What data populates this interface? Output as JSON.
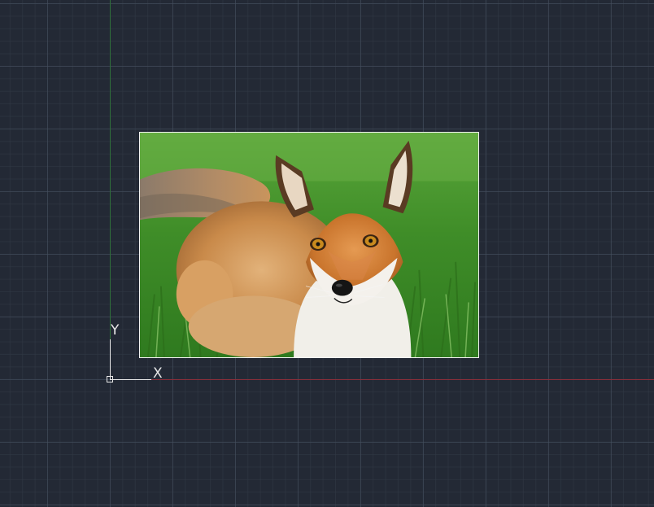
{
  "viewport": {
    "background_color": "#232935",
    "axis_x_color": "#8a2e3a",
    "axis_y_color": "#2f6e3a"
  },
  "ucs_icon": {
    "x_label": "X",
    "y_label": "Y",
    "color": "#e8e8e8"
  },
  "raster_image": {
    "subject": "red-fox-in-grass-photo",
    "frame_color": "#f2f2f2"
  }
}
